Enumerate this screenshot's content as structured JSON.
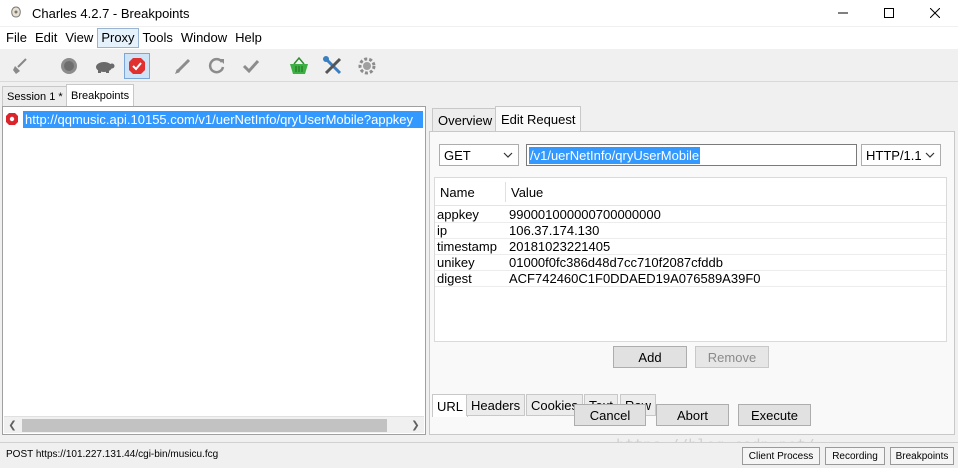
{
  "window": {
    "title": "Charles 4.2.7 - Breakpoints"
  },
  "menu": [
    "File",
    "Edit",
    "View",
    "Proxy",
    "Tools",
    "Window",
    "Help"
  ],
  "menu_active": "Proxy",
  "toolbar": {
    "icons": [
      "broom-icon",
      "record-icon",
      "turtle-icon",
      "breakpoint-icon",
      "pen-icon",
      "refresh-icon",
      "check-icon",
      "basket-icon",
      "tools-icon",
      "settings-icon"
    ],
    "pressed": "breakpoint-icon"
  },
  "session_tabs": [
    "Session 1 *",
    "Breakpoints"
  ],
  "active_session_tab": "Breakpoints",
  "request_list": [
    {
      "url": "http://qqmusic.api.10155.com/v1/uerNetInfo/qryUserMobile?appkey",
      "status": "breakpoint"
    }
  ],
  "right_tabs": [
    "Overview",
    "Edit Request"
  ],
  "active_right_tab": "Edit Request",
  "edit_request": {
    "method": "GET",
    "path": "/v1/uerNetInfo/qryUserMobile",
    "protocol": "HTTP/1.1",
    "columns": [
      "Name",
      "Value"
    ],
    "params": [
      {
        "name": "appkey",
        "value": "990001000000700000000"
      },
      {
        "name": "ip",
        "value": "106.37.174.130"
      },
      {
        "name": "timestamp",
        "value": "20181023221405"
      },
      {
        "name": "unikey",
        "value": "01000f0fc386d48d7cc710f2087cfddb"
      },
      {
        "name": "digest",
        "value": "ACF742460C1F0DDAED19A076589A39F0"
      }
    ],
    "add_label": "Add",
    "remove_label": "Remove",
    "bottom_tabs": [
      "URL",
      "Headers",
      "Cookies",
      "Text",
      "Raw"
    ],
    "active_bottom_tab": "URL"
  },
  "actions": {
    "cancel": "Cancel",
    "abort": "Abort",
    "execute": "Execute"
  },
  "status": {
    "text": "POST https://101.227.131.44/cgi-bin/musicu.fcg",
    "client_process": "Client Process",
    "recording": "Recording",
    "breakpoints": "Breakpoints"
  },
  "watermark": "https://blog.csdn.net/..."
}
